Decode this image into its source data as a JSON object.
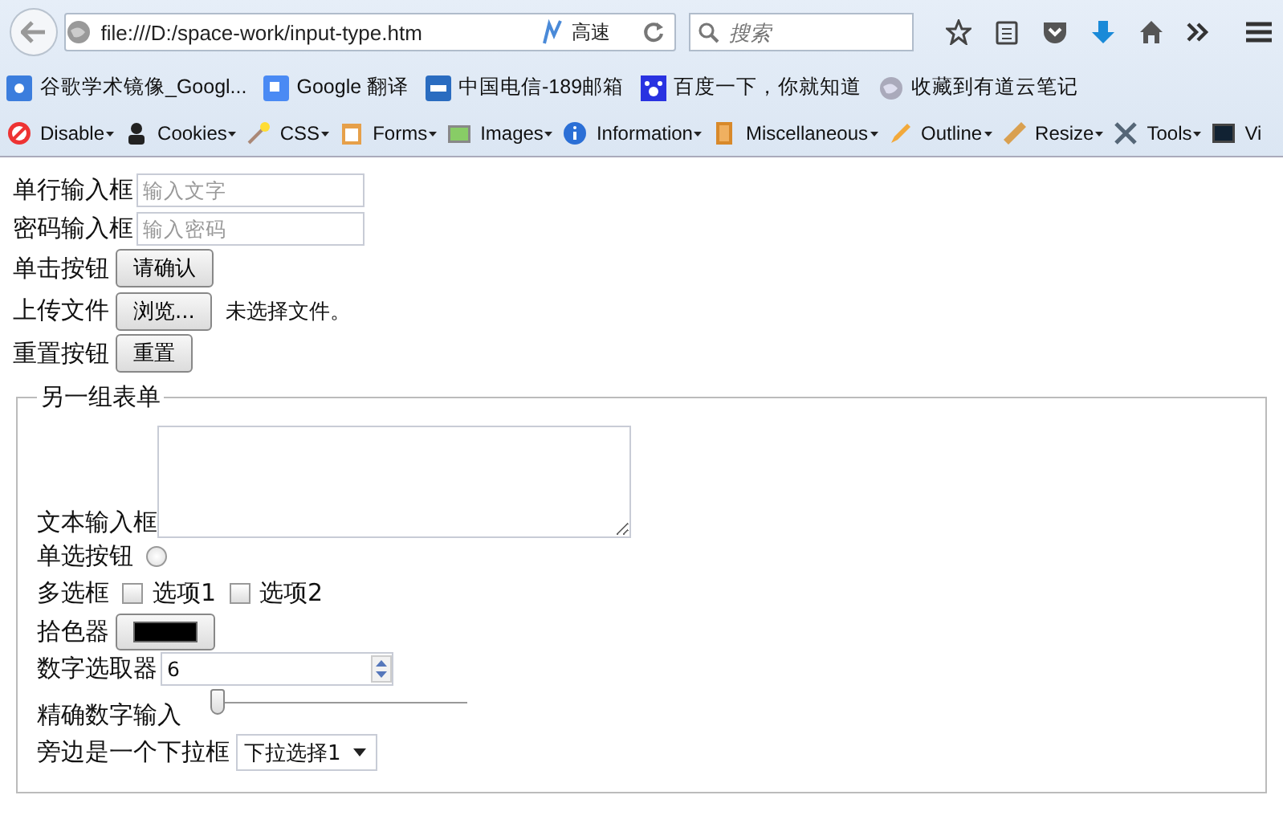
{
  "browser": {
    "url": "file:///D:/space-work/input-type.htm",
    "speed_label": "高速",
    "search_placeholder": "搜索"
  },
  "bookmarks": [
    {
      "kind": "scholar",
      "label": "谷歌学术镜像_Googl..."
    },
    {
      "kind": "translate",
      "label": "Google 翻译"
    },
    {
      "kind": "mail",
      "label": "中国电信-189邮箱"
    },
    {
      "kind": "paw",
      "label": "百度一下，你就知道"
    },
    {
      "kind": "globe",
      "label": "收藏到有道云笔记"
    }
  ],
  "dev_toolbar": [
    {
      "kind": "disable",
      "label": "Disable"
    },
    {
      "kind": "cookies",
      "label": "Cookies"
    },
    {
      "kind": "css",
      "label": "CSS"
    },
    {
      "kind": "forms",
      "label": "Forms"
    },
    {
      "kind": "images",
      "label": "Images"
    },
    {
      "kind": "information",
      "label": "Information"
    },
    {
      "kind": "misc",
      "label": "Miscellaneous"
    },
    {
      "kind": "outline",
      "label": "Outline"
    },
    {
      "kind": "resize",
      "label": "Resize"
    },
    {
      "kind": "tools",
      "label": "Tools"
    },
    {
      "kind": "view",
      "label": "Vi"
    }
  ],
  "form": [
    {
      "kind": "text",
      "label": "单行输入框",
      "placeholder": "输入文字"
    },
    {
      "kind": "text",
      "label": "密码输入框",
      "placeholder": "输入密码"
    },
    {
      "kind": "button",
      "label": "单击按钮",
      "button": "请确认"
    },
    {
      "kind": "file",
      "label": "上传文件",
      "button": "浏览...",
      "status": "未选择文件。"
    },
    {
      "kind": "button",
      "label": "重置按钮",
      "button": "重置"
    }
  ],
  "fieldset": {
    "legend": "另一组表单",
    "rows": [
      {
        "kind": "textarea",
        "label": "文本输入框"
      },
      {
        "kind": "radio",
        "label": "单选按钮",
        "checked": false
      },
      {
        "kind": "checkboxes",
        "label": "多选框",
        "options": [
          {
            "label": "选项1",
            "checked": false
          },
          {
            "label": "选项2",
            "checked": false
          }
        ]
      },
      {
        "kind": "color",
        "label": "拾色器",
        "color": "#000000"
      },
      {
        "kind": "number",
        "label": "数字选取器",
        "value": "6"
      },
      {
        "kind": "range",
        "label": "精确数字输入",
        "level": 0
      },
      {
        "kind": "select",
        "label": "旁边是一个下拉框",
        "value": "下拉选择1"
      }
    ]
  }
}
